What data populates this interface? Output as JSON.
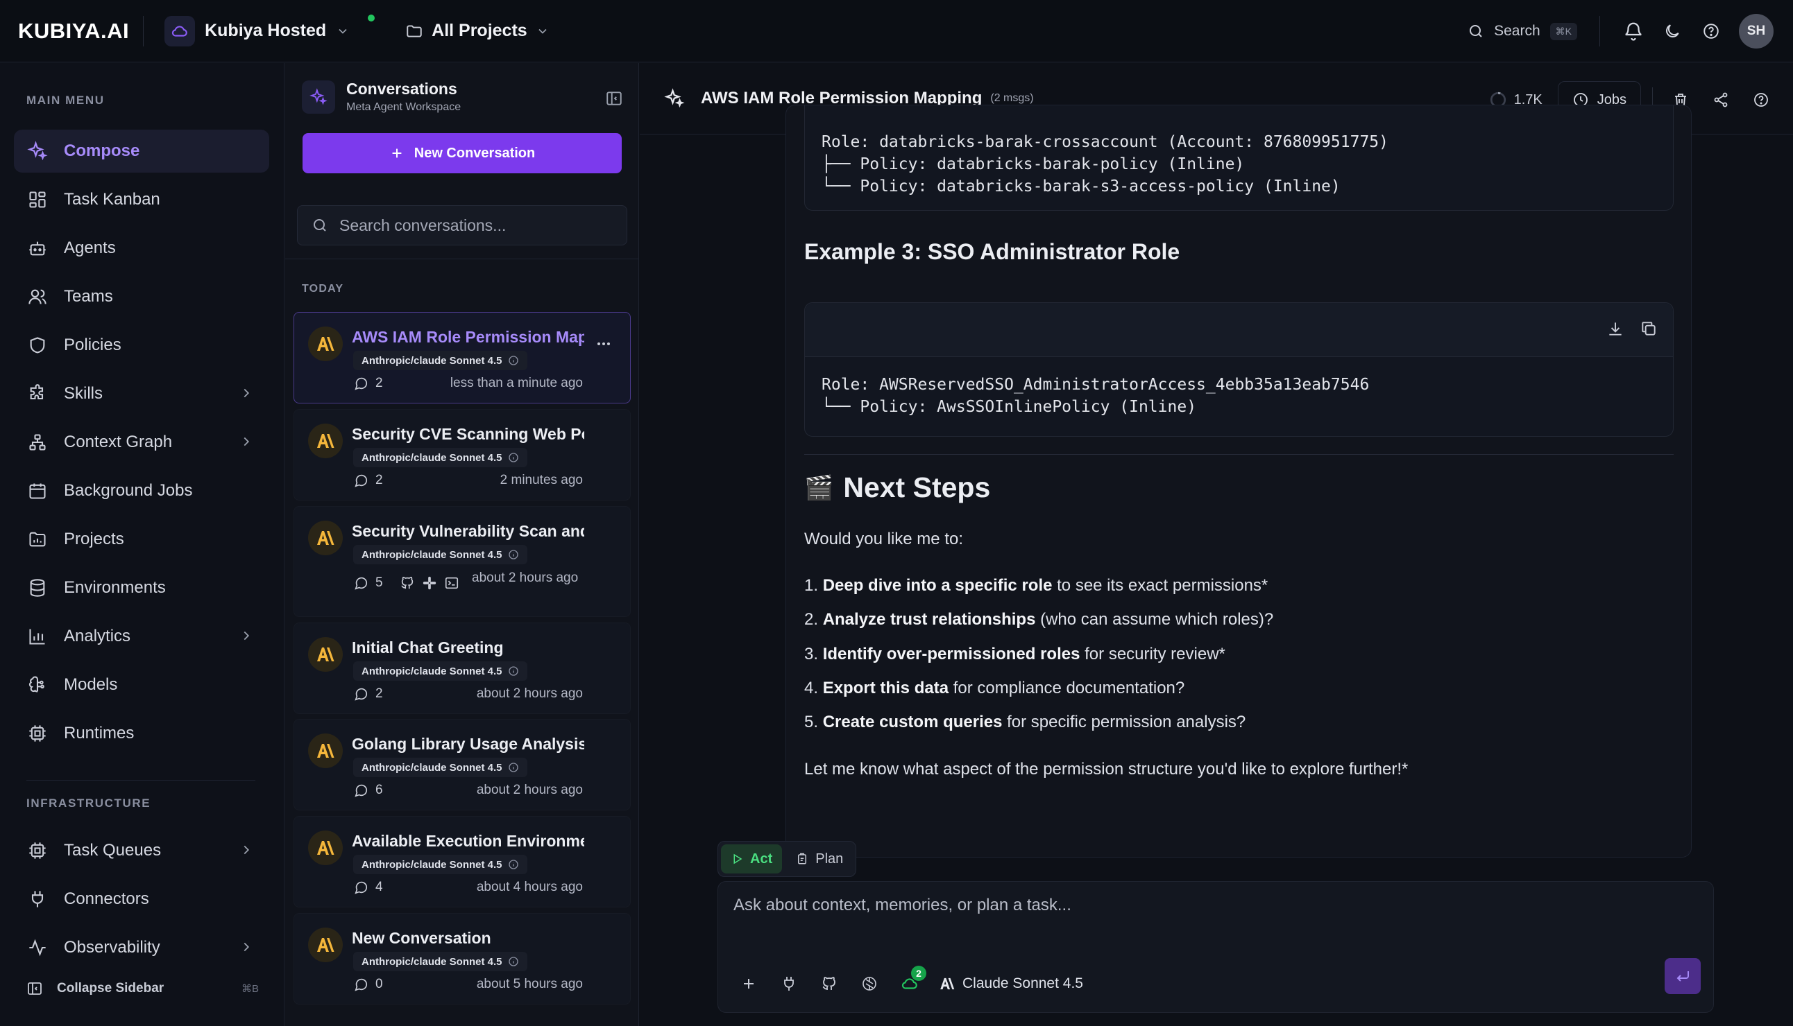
{
  "app": {
    "logo": "KUBIYA.AI",
    "environment": "Kubiya Hosted",
    "project": "All Projects",
    "search_label": "Search",
    "search_kbd": "⌘K",
    "user_initials": "SH"
  },
  "sidebar": {
    "main_menu_label": "MAIN MENU",
    "items": [
      {
        "label": "Compose",
        "icon": "sparkle-icon",
        "active": true
      },
      {
        "label": "Task Kanban",
        "icon": "kanban-icon"
      },
      {
        "label": "Agents",
        "icon": "robot-icon"
      },
      {
        "label": "Teams",
        "icon": "users-icon"
      },
      {
        "label": "Policies",
        "icon": "shield-icon"
      },
      {
        "label": "Skills",
        "icon": "puzzle-icon",
        "expandable": true
      },
      {
        "label": "Context Graph",
        "icon": "graph-icon",
        "expandable": true
      },
      {
        "label": "Background Jobs",
        "icon": "calendar-icon"
      },
      {
        "label": "Projects",
        "icon": "folder-chart-icon"
      },
      {
        "label": "Environments",
        "icon": "database-icon"
      },
      {
        "label": "Analytics",
        "icon": "bar-chart-icon",
        "expandable": true
      },
      {
        "label": "Models",
        "icon": "brain-icon"
      },
      {
        "label": "Runtimes",
        "icon": "cpu-icon"
      }
    ],
    "infrastructure_label": "INFRASTRUCTURE",
    "infra_items": [
      {
        "label": "Task Queues",
        "icon": "cpu-icon",
        "expandable": true
      },
      {
        "label": "Connectors",
        "icon": "plug-icon"
      },
      {
        "label": "Observability",
        "icon": "activity-icon",
        "expandable": true
      }
    ],
    "collapse_label": "Collapse Sidebar",
    "collapse_kbd": "⌘B"
  },
  "conversations": {
    "title": "Conversations",
    "subtitle": "Meta Agent Workspace",
    "new_button": "New Conversation",
    "search_placeholder": "Search conversations...",
    "group_label": "TODAY",
    "items": [
      {
        "title": "AWS IAM Role Permission Mapping",
        "model": "Anthropic/claude Sonnet 4.5",
        "count": "2",
        "time": "less than a minute ago",
        "active": true
      },
      {
        "title": "Security CVE Scanning Web Portal",
        "model": "Anthropic/claude Sonnet 4.5",
        "count": "2",
        "time": "2 minutes ago"
      },
      {
        "title": "Security Vulnerability Scan and Report",
        "model": "Anthropic/claude Sonnet 4.5",
        "count": "5",
        "time": "about 2 hours ago",
        "integrations": [
          "github-icon",
          "slack-icon",
          "terminal-icon"
        ]
      },
      {
        "title": "Initial Chat Greeting",
        "model": "Anthropic/claude Sonnet 4.5",
        "count": "2",
        "time": "about 2 hours ago"
      },
      {
        "title": "Golang Library Usage Analysis",
        "model": "Anthropic/claude Sonnet 4.5",
        "count": "6",
        "time": "about 2 hours ago"
      },
      {
        "title": "Available Execution Environments",
        "model": "Anthropic/claude Sonnet 4.5",
        "count": "4",
        "time": "about 4 hours ago"
      },
      {
        "title": "New Conversation",
        "model": "Anthropic/claude Sonnet 4.5",
        "count": "0",
        "time": "about 5 hours ago"
      }
    ]
  },
  "chat": {
    "title": "AWS IAM Role Permission Mapping",
    "msg_count": "(2 msgs)",
    "tokens": "1.7K",
    "jobs_label": "Jobs",
    "code1": "Role: databricks-barak-crossaccount (Account: 876809951775)\n├── Policy: databricks-barak-policy (Inline)\n└── Policy: databricks-barak-s3-access-policy (Inline)",
    "example3_heading": "Example 3: SSO Administrator Role",
    "code2": "Role: AWSReservedSSO_AdministratorAccess_4ebb35a13eab7546\n└── Policy: AwsSSOInlinePolicy (Inline)",
    "next_steps_emoji": "🎬",
    "next_steps_heading": "Next Steps",
    "intro": "Would you like me to:",
    "steps": [
      {
        "num": "1.",
        "bold": "Deep dive into a specific role",
        "rest": " to see its exact permissions*"
      },
      {
        "num": "2.",
        "bold": "Analyze trust relationships",
        "rest": " (who can assume which roles)?"
      },
      {
        "num": "3.",
        "bold": "Identify over-permissioned roles",
        "rest": " for security review*"
      },
      {
        "num": "4.",
        "bold": "Export this data",
        "rest": " for compliance documentation?"
      },
      {
        "num": "5.",
        "bold": "Create custom queries",
        "rest": " for specific permission analysis?"
      }
    ],
    "closing": "Let me know what aspect of the permission structure you'd like to explore further!*",
    "mode_act": "Act",
    "mode_plan": "Plan",
    "composer_placeholder": "Ask about context, memories, or plan a task...",
    "env_badge": "2",
    "model_label": "Claude Sonnet 4.5"
  },
  "colors": {
    "accent": "#7c3aed",
    "accent_text": "#a78bfa",
    "success": "#22c55e",
    "background": "#0d1017"
  }
}
